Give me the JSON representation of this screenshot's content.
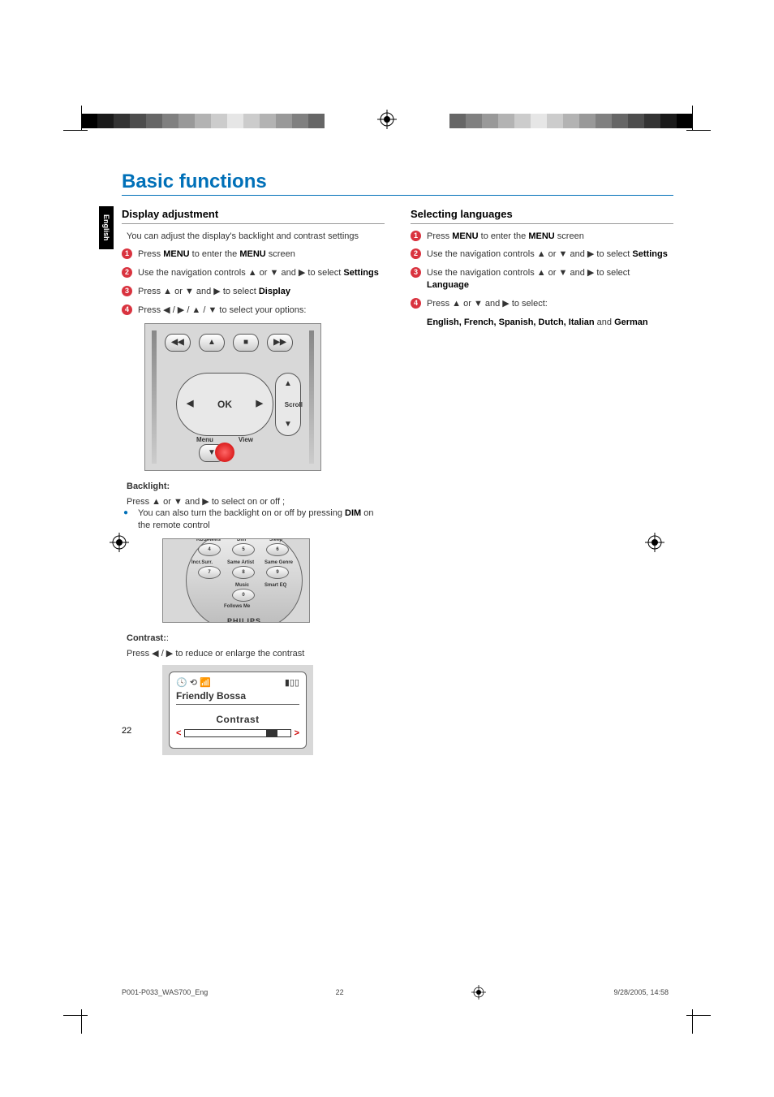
{
  "lang_tab": "English",
  "page_title": "Basic functions",
  "page_number": "22",
  "footer": {
    "doc": "P001-P033_WAS700_Eng",
    "page": "22",
    "date": "9/28/2005, 14:58"
  },
  "left": {
    "heading": "Display adjustment",
    "intro": "You can adjust the display's  backlight and contrast settings",
    "s1_a": "Press ",
    "s1_b": "MENU",
    "s1_c": " to enter the ",
    "s1_d": "MENU",
    "s1_e": " screen",
    "s2_a": "Use the navigation controls ▲ or ▼ and ▶ to select ",
    "s2_b": "Settings",
    "s3_a": "Press ▲ or ▼ and ▶ to  select ",
    "s3_b": "Display",
    "s4_a": "Press ◀ / ▶ / ▲ / ▼ to select  your options:",
    "navpad": {
      "ok": "OK",
      "menu": "Menu",
      "view": "View",
      "scroll": "Scroll"
    },
    "backlight_hd": "Backlight:",
    "bl_line1": "Press ▲ or ▼ and ▶ to select on or off ;",
    "bl_bullet_a": "You can also turn the backlight on or off by pressing ",
    "bl_bullet_b": "DIM",
    "bl_bullet_c": " on the remote control",
    "remote": {
      "row1_l": "RDS/News",
      "row1_c": "Dim",
      "row1_r": "Sleep",
      "btn4": "4\nghi",
      "btn5": "5\njkl",
      "btn6": "6\nmno",
      "row2_l": "Incr.Surr.",
      "row2_c": "Same Artist",
      "row2_r": "Same Genre",
      "btn7": "7\npqrs",
      "btn8": "8\ntuv",
      "btn9": "9\nwxyz",
      "row3_c": "Music",
      "row3_r": "Smart EQ",
      "btn0": "0",
      "follows": "Follows Me",
      "brand": "PHILIPS"
    },
    "contrast_hd": "Contrast:",
    "contrast_line": "Press ◀ / ▶ to reduce or enlarge the contrast",
    "lcd": {
      "title": "Friendly Bossa",
      "label": "Contrast"
    }
  },
  "right": {
    "heading": "Selecting languages",
    "s1_a": "Press ",
    "s1_b": "MENU",
    "s1_c": " to enter the ",
    "s1_d": "MENU",
    "s1_e": " screen",
    "s2_a": "Use the navigation controls ▲ or ▼ and ▶ to select ",
    "s2_b": "Settings",
    "s3_a": "Use the navigation controls ▲ or ▼ and ▶ to select ",
    "s3_b": "Language",
    "s4_a": "Press ▲ or ▼ and ▶ to  select:",
    "langs_a": "English, French, Spanish, Dutch, Italian",
    "langs_b": " and ",
    "langs_c": "German"
  }
}
